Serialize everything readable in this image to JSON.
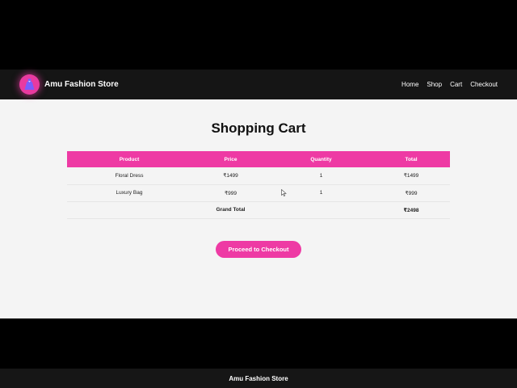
{
  "brand": {
    "name": "Amu Fashion Store",
    "logo_icon": "dress-icon",
    "accent": "#ee3aa4"
  },
  "nav": {
    "links": [
      "Home",
      "Shop",
      "Cart",
      "Checkout"
    ]
  },
  "page": {
    "title": "Shopping Cart"
  },
  "cart": {
    "columns": [
      "Product",
      "Price",
      "Quantity",
      "Total"
    ],
    "rows": [
      {
        "product": "Floral Dress",
        "price": "₹1499",
        "quantity": "1",
        "total": "₹1499"
      },
      {
        "product": "Luxury Bag",
        "price": "₹999",
        "quantity": "1",
        "total": "₹999"
      }
    ],
    "grand_total_label": "Grand Total",
    "grand_total_value": "₹2498"
  },
  "actions": {
    "checkout_label": "Proceed to Checkout"
  },
  "footer": {
    "text": "Amu Fashion Store"
  }
}
